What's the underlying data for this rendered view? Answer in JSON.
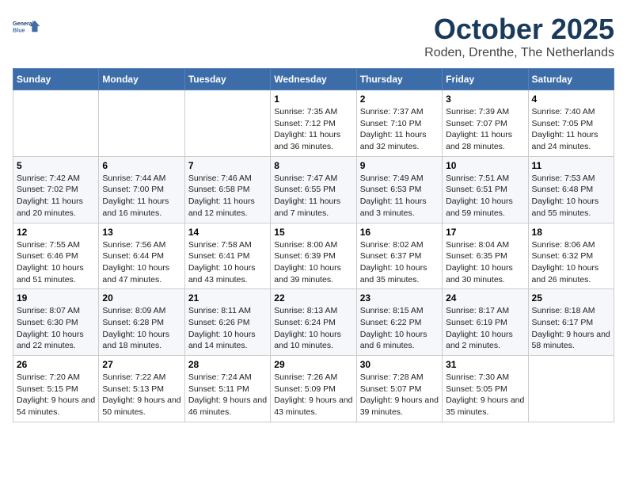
{
  "header": {
    "logo_line1": "General",
    "logo_line2": "Blue",
    "title": "October 2025",
    "subtitle": "Roden, Drenthe, The Netherlands"
  },
  "weekdays": [
    "Sunday",
    "Monday",
    "Tuesday",
    "Wednesday",
    "Thursday",
    "Friday",
    "Saturday"
  ],
  "weeks": [
    [
      {
        "day": "",
        "info": ""
      },
      {
        "day": "",
        "info": ""
      },
      {
        "day": "",
        "info": ""
      },
      {
        "day": "1",
        "info": "Sunrise: 7:35 AM\nSunset: 7:12 PM\nDaylight: 11 hours and 36 minutes."
      },
      {
        "day": "2",
        "info": "Sunrise: 7:37 AM\nSunset: 7:10 PM\nDaylight: 11 hours and 32 minutes."
      },
      {
        "day": "3",
        "info": "Sunrise: 7:39 AM\nSunset: 7:07 PM\nDaylight: 11 hours and 28 minutes."
      },
      {
        "day": "4",
        "info": "Sunrise: 7:40 AM\nSunset: 7:05 PM\nDaylight: 11 hours and 24 minutes."
      }
    ],
    [
      {
        "day": "5",
        "info": "Sunrise: 7:42 AM\nSunset: 7:02 PM\nDaylight: 11 hours and 20 minutes."
      },
      {
        "day": "6",
        "info": "Sunrise: 7:44 AM\nSunset: 7:00 PM\nDaylight: 11 hours and 16 minutes."
      },
      {
        "day": "7",
        "info": "Sunrise: 7:46 AM\nSunset: 6:58 PM\nDaylight: 11 hours and 12 minutes."
      },
      {
        "day": "8",
        "info": "Sunrise: 7:47 AM\nSunset: 6:55 PM\nDaylight: 11 hours and 7 minutes."
      },
      {
        "day": "9",
        "info": "Sunrise: 7:49 AM\nSunset: 6:53 PM\nDaylight: 11 hours and 3 minutes."
      },
      {
        "day": "10",
        "info": "Sunrise: 7:51 AM\nSunset: 6:51 PM\nDaylight: 10 hours and 59 minutes."
      },
      {
        "day": "11",
        "info": "Sunrise: 7:53 AM\nSunset: 6:48 PM\nDaylight: 10 hours and 55 minutes."
      }
    ],
    [
      {
        "day": "12",
        "info": "Sunrise: 7:55 AM\nSunset: 6:46 PM\nDaylight: 10 hours and 51 minutes."
      },
      {
        "day": "13",
        "info": "Sunrise: 7:56 AM\nSunset: 6:44 PM\nDaylight: 10 hours and 47 minutes."
      },
      {
        "day": "14",
        "info": "Sunrise: 7:58 AM\nSunset: 6:41 PM\nDaylight: 10 hours and 43 minutes."
      },
      {
        "day": "15",
        "info": "Sunrise: 8:00 AM\nSunset: 6:39 PM\nDaylight: 10 hours and 39 minutes."
      },
      {
        "day": "16",
        "info": "Sunrise: 8:02 AM\nSunset: 6:37 PM\nDaylight: 10 hours and 35 minutes."
      },
      {
        "day": "17",
        "info": "Sunrise: 8:04 AM\nSunset: 6:35 PM\nDaylight: 10 hours and 30 minutes."
      },
      {
        "day": "18",
        "info": "Sunrise: 8:06 AM\nSunset: 6:32 PM\nDaylight: 10 hours and 26 minutes."
      }
    ],
    [
      {
        "day": "19",
        "info": "Sunrise: 8:07 AM\nSunset: 6:30 PM\nDaylight: 10 hours and 22 minutes."
      },
      {
        "day": "20",
        "info": "Sunrise: 8:09 AM\nSunset: 6:28 PM\nDaylight: 10 hours and 18 minutes."
      },
      {
        "day": "21",
        "info": "Sunrise: 8:11 AM\nSunset: 6:26 PM\nDaylight: 10 hours and 14 minutes."
      },
      {
        "day": "22",
        "info": "Sunrise: 8:13 AM\nSunset: 6:24 PM\nDaylight: 10 hours and 10 minutes."
      },
      {
        "day": "23",
        "info": "Sunrise: 8:15 AM\nSunset: 6:22 PM\nDaylight: 10 hours and 6 minutes."
      },
      {
        "day": "24",
        "info": "Sunrise: 8:17 AM\nSunset: 6:19 PM\nDaylight: 10 hours and 2 minutes."
      },
      {
        "day": "25",
        "info": "Sunrise: 8:18 AM\nSunset: 6:17 PM\nDaylight: 9 hours and 58 minutes."
      }
    ],
    [
      {
        "day": "26",
        "info": "Sunrise: 7:20 AM\nSunset: 5:15 PM\nDaylight: 9 hours and 54 minutes."
      },
      {
        "day": "27",
        "info": "Sunrise: 7:22 AM\nSunset: 5:13 PM\nDaylight: 9 hours and 50 minutes."
      },
      {
        "day": "28",
        "info": "Sunrise: 7:24 AM\nSunset: 5:11 PM\nDaylight: 9 hours and 46 minutes."
      },
      {
        "day": "29",
        "info": "Sunrise: 7:26 AM\nSunset: 5:09 PM\nDaylight: 9 hours and 43 minutes."
      },
      {
        "day": "30",
        "info": "Sunrise: 7:28 AM\nSunset: 5:07 PM\nDaylight: 9 hours and 39 minutes."
      },
      {
        "day": "31",
        "info": "Sunrise: 7:30 AM\nSunset: 5:05 PM\nDaylight: 9 hours and 35 minutes."
      },
      {
        "day": "",
        "info": ""
      }
    ]
  ]
}
